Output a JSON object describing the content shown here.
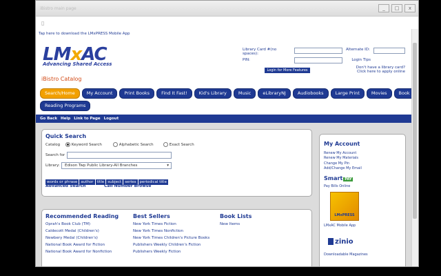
{
  "window": {
    "title": "iBistro main page",
    "controls": [
      "_",
      "□",
      "x"
    ]
  },
  "top": {
    "mobile_link": "Tap here to download the LMxPRESS Mobile App"
  },
  "logo": {
    "text_a": "LM",
    "text_x": "x",
    "text_b": "AC",
    "tagline": "Advancing Shared Access"
  },
  "catalog_title": "iBistro Catalog",
  "login": {
    "card_label": "Library Card #(no spaces):",
    "pin_label": "PIN:",
    "button": "Login for More Features",
    "alt_id_label": "Alternate ID:",
    "login_tips": "Login Tips",
    "no_card": "Don't have a library card?",
    "apply_online": "Click here to apply online"
  },
  "nav_row1": [
    "Search/Home",
    "My Account",
    "Print Books",
    "Find It Fast!",
    "Kid's Library",
    "Music",
    "eLibraryNJ",
    "Audiobooks",
    "Large Print",
    "Movies",
    "Book Discussion Kits"
  ],
  "nav_row2": [
    "Reading Programs"
  ],
  "linkbar": [
    "Go Back",
    "Help",
    "Link to Page",
    "Logout"
  ],
  "quick_search": {
    "title": "Quick Search",
    "catalog_label": "Catalog",
    "options": [
      "Keyword Search",
      "Alphabetic Search",
      "Exact Search"
    ],
    "search_for_label": "Search for",
    "search_value": "",
    "library_label": "Library:",
    "library_value": "Edison Twp Public Library-All Branches",
    "tags": [
      "words or phrase",
      "author",
      "title",
      "subject",
      "series",
      "periodical title"
    ],
    "advanced": "Advanced Search",
    "call_number": "Call Number Browse"
  },
  "recommended": {
    "title": "Recommended Reading",
    "items": [
      "Oprah's Book Club (TM)",
      "Caldecott Medal (Children's)",
      "Newbery Medal (Children's)",
      "National Book Award for Fiction",
      "National Book Award for Nonfiction"
    ]
  },
  "bestsellers": {
    "title": "Best Sellers",
    "items": [
      "New York Times Fiction",
      "New York Times Nonfiction",
      "New York Times Children's Picture Books",
      "Publishers Weekly Children's Fiction",
      "Publishers Weekly Fiction"
    ]
  },
  "booklists": {
    "title": "Book Lists",
    "items": [
      "New Items"
    ]
  },
  "my_account": {
    "title": "My Account",
    "links": [
      "Renew My Account",
      "Renew My Materials",
      "Change My Pin",
      "Add/Change My Email"
    ],
    "smartpay_a": "Smart",
    "smartpay_b": "PAY",
    "pay_bills": "Pay Bills Online",
    "mobile_app_label": "LMxAC Mobile App",
    "mobile_logo": "LMxPRESS",
    "zinio": "zinio",
    "downloadable": "Downloadable Magazines"
  }
}
